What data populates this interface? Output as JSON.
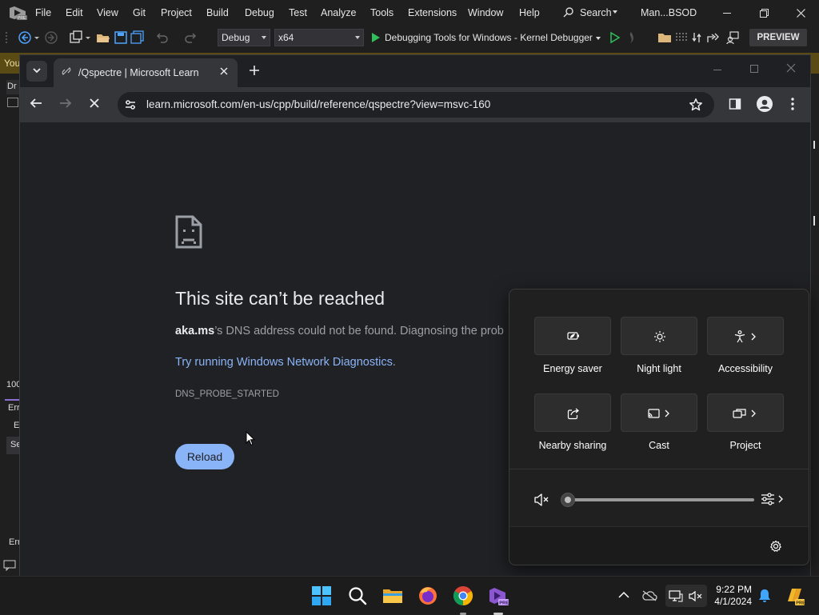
{
  "vs": {
    "menu": [
      "File",
      "Edit",
      "View",
      "Git",
      "Project",
      "Build",
      "Debug",
      "Test",
      "Analyze",
      "Tools",
      "Extensions",
      "Window",
      "Help"
    ],
    "search_label": "Search",
    "solution_name": "Man...BSOD",
    "config_combo": "Debug",
    "platform_combo": "x64",
    "debugger_label": "Debugging Tools for Windows - Kernel Debugger",
    "preview_label": "PREVIEW",
    "yellowbar_text": "You",
    "side_labels": [
      "Dr",
      "100",
      "Err",
      "E",
      "Se",
      "Err"
    ]
  },
  "chrome": {
    "tab_title": "/Qspectre | Microsoft Learn",
    "url": "learn.microsoft.com/en-us/cpp/build/reference/qspectre?view=msvc-160"
  },
  "error_page": {
    "title": "This site can’t be reached",
    "host": "aka.ms",
    "message": "’s DNS address could not be found. Diagnosing the prob",
    "suggestion_prefix": "Try running ",
    "suggestion_link": "Windows Network Diagnostics",
    "suggestion_suffix": ".",
    "error_code": "DNS_PROBE_STARTED",
    "reload_label": "Reload"
  },
  "quick_settings": {
    "tiles": [
      {
        "label": "Energy saver",
        "icon": "energy-saver-icon"
      },
      {
        "label": "Night light",
        "icon": "night-light-icon"
      },
      {
        "label": "Accessibility",
        "icon": "accessibility-icon"
      },
      {
        "label": "Nearby sharing",
        "icon": "nearby-sharing-icon"
      },
      {
        "label": "Cast",
        "icon": "cast-icon"
      },
      {
        "label": "Project",
        "icon": "project-icon"
      }
    ],
    "volume_level": 0
  },
  "taskbar": {
    "time": "9:22 PM",
    "date": "4/1/2024"
  },
  "colors": {
    "link": "#8ab4f8",
    "reload_button": "#8ab4f8",
    "vs_accent": "#4ec9b0"
  }
}
